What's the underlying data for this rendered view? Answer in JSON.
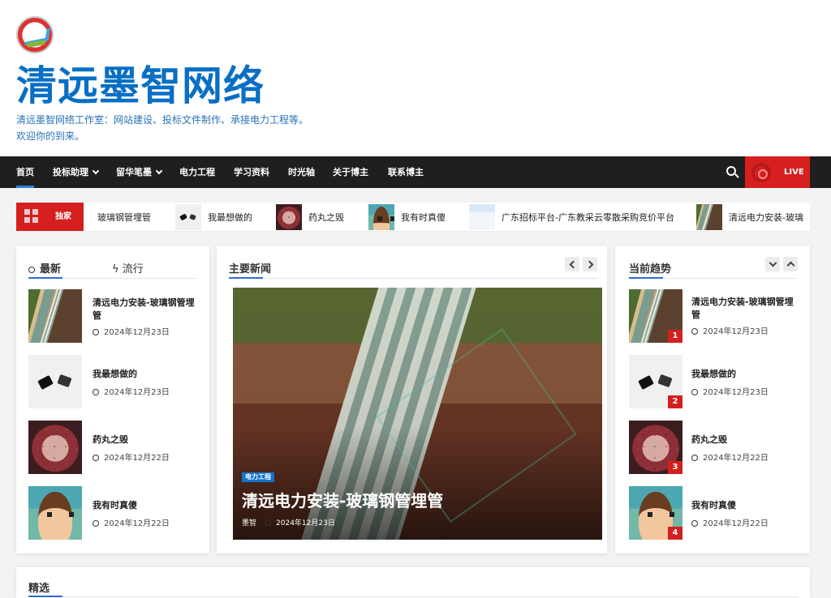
{
  "site": {
    "title": "清远墨智网络",
    "description_line1": "清远墨智网络工作室：网站建设、投标文件制作、承接电力工程等。",
    "description_line2": "欢迎你的到来。"
  },
  "nav": {
    "items": [
      "首页",
      "投标助理",
      "留华笔墨",
      "电力工程",
      "学习资料",
      "时光轴",
      "关于博主",
      "联系博主"
    ],
    "live_label": "LIVE"
  },
  "ticker": {
    "badge": "独家",
    "items": [
      "玻璃钢管埋管",
      "我最想做的",
      "药丸之毁",
      "我有时真傻",
      "广东招标平台-广东教采云零散采购竞价平台",
      "清远电力安装-玻璃"
    ]
  },
  "left": {
    "tab_recent": "最新",
    "tab_popular": "流行",
    "posts": [
      {
        "title": "清远电力安装-玻璃钢管埋管",
        "date": "2024年12月23日",
        "icon": "pipe"
      },
      {
        "title": "我最想做的",
        "date": "2024年12月23日",
        "icon": "stone"
      },
      {
        "title": "药丸之毁",
        "date": "2024年12月22日",
        "icon": "ball"
      },
      {
        "title": "我有时真傻",
        "date": "2024年12月22日",
        "icon": "girl"
      }
    ]
  },
  "main_news": {
    "heading": "主要新闻",
    "category": "电力工程",
    "title": "清远电力安装-玻璃钢管埋管",
    "author": "墨智",
    "date": "2024年12月23日"
  },
  "trending": {
    "heading": "当前趋势",
    "posts": [
      {
        "rank": "1",
        "title": "清远电力安装-玻璃钢管埋管",
        "date": "2024年12月23日"
      },
      {
        "rank": "2",
        "title": "我最想做的",
        "date": "2024年12月23日"
      },
      {
        "rank": "3",
        "title": "药丸之毁",
        "date": "2024年12月22日"
      },
      {
        "rank": "4",
        "title": "我有时真傻",
        "date": "2024年12月22日"
      }
    ]
  },
  "featured": {
    "heading": "精选"
  },
  "colors": {
    "brand": "#086fc5",
    "live": "#d71f1f",
    "dark": "#1f1f1f"
  }
}
